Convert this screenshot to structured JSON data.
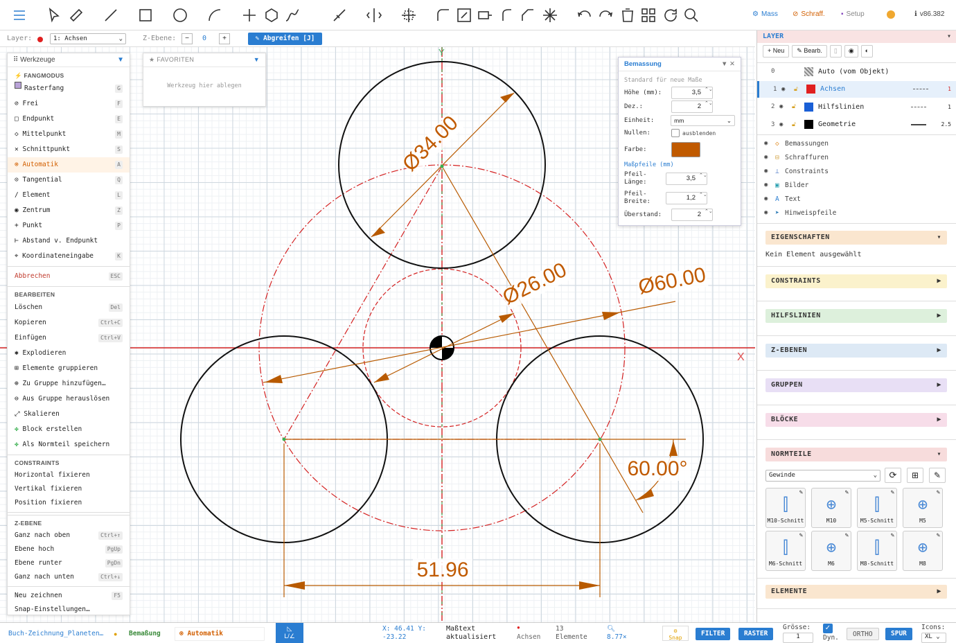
{
  "toolbar": {
    "mass": "Mass",
    "schraff": "Schraff.",
    "setup": "Setup",
    "version": "v86.382"
  },
  "layerbar": {
    "layer_label": "Layer:",
    "layer_value": "1: Achsen",
    "zebene_label": "Z-Ebene:",
    "zebene_value": "0",
    "abgreifen": "Abgreifen [J]"
  },
  "tools": {
    "title": "Werkzeuge",
    "fang_header": "FANGMODUS",
    "fang": [
      {
        "label": "Rasterfang",
        "key": "G"
      },
      {
        "label": "Frei",
        "key": "F"
      },
      {
        "label": "Endpunkt",
        "key": "E"
      },
      {
        "label": "Mittelpunkt",
        "key": "M"
      },
      {
        "label": "Schnittpunkt",
        "key": "S"
      },
      {
        "label": "Automatik",
        "key": "A"
      },
      {
        "label": "Tangential",
        "key": "Q"
      },
      {
        "label": "Element",
        "key": "L"
      },
      {
        "label": "Zentrum",
        "key": "Z"
      },
      {
        "label": "Punkt",
        "key": "P"
      },
      {
        "label": "Abstand v. Endpunkt",
        "key": ""
      },
      {
        "label": "Koordinateneingabe",
        "key": "K"
      }
    ],
    "abbrechen": {
      "label": "Abbrechen",
      "key": "ESC"
    },
    "bearbeiten_header": "BEARBEITEN",
    "bearbeiten": [
      {
        "label": "Löschen",
        "key": "Del"
      },
      {
        "label": "Kopieren",
        "key": "Ctrl+C"
      },
      {
        "label": "Einfügen",
        "key": "Ctrl+V"
      },
      {
        "label": "Explodieren",
        "key": ""
      },
      {
        "label": "Elemente gruppieren",
        "key": ""
      },
      {
        "label": "Zu Gruppe hinzufügen…",
        "key": ""
      },
      {
        "label": "Aus Gruppe herauslösen",
        "key": ""
      },
      {
        "label": "Skalieren",
        "key": ""
      },
      {
        "label": "Block erstellen",
        "key": ""
      },
      {
        "label": "Als Normteil speichern",
        "key": ""
      }
    ],
    "constraints_header": "CONSTRAINTS",
    "constraints": [
      "Horizontal fixieren",
      "Vertikal fixieren",
      "Position fixieren"
    ],
    "zebene_header": "Z-EBENE",
    "zebene": [
      {
        "label": "Ganz nach oben",
        "key": "Ctrl+↑"
      },
      {
        "label": "Ebene hoch",
        "key": "PgUp"
      },
      {
        "label": "Ebene runter",
        "key": "PgDn"
      },
      {
        "label": "Ganz nach unten",
        "key": "Ctrl+↓"
      }
    ],
    "neu_zeichnen": {
      "label": "Neu zeichnen",
      "key": "F5"
    },
    "snap_settings": "Snap-Einstellungen…"
  },
  "favoriten": {
    "title": "FAVORITEN",
    "placeholder": "Werkzeug hier ablegen"
  },
  "dim_panel": {
    "title": "Bemassung",
    "subtitle": "Standard für neue Maße",
    "hoehe_label": "Höhe (mm):",
    "hoehe": "3,5",
    "dez_label": "Dez.:",
    "dez": "2",
    "einheit_label": "Einheit:",
    "einheit": "mm",
    "nullen_label": "Nullen:",
    "nullen_opt": "ausblenden",
    "farbe_label": "Farbe:",
    "farbe": "#c05a00",
    "pfeile_header": "Maßpfeile (mm)",
    "pfeil_laenge_label": "Pfeil-Länge:",
    "pfeil_laenge": "3,5",
    "pfeil_breite_label": "Pfeil-Breite:",
    "pfeil_breite": "1,2",
    "ueberstand_label": "Überstand:",
    "ueberstand": "2"
  },
  "drawing": {
    "dims": {
      "d34": "Ø34.00",
      "d26": "Ø26.00",
      "d60": "Ø60.00",
      "len": "51.96",
      "ang": "60.00°"
    },
    "axis_x": "X",
    "axis_y": "Y"
  },
  "right": {
    "layer_title": "LAYER",
    "neu": "Neu",
    "bearb": "Bearb.",
    "layers": [
      {
        "num": "0",
        "name": "Auto (vom Objekt)",
        "color": ""
      },
      {
        "num": "1",
        "name": "Achsen",
        "color": "#e02020",
        "lw": "1"
      },
      {
        "num": "2",
        "name": "Hilfslinien",
        "color": "#1a5fd6",
        "lw": "1"
      },
      {
        "num": "3",
        "name": "Geometrie",
        "color": "#000000",
        "lw": "2.5"
      }
    ],
    "visibility": [
      {
        "icon": "◇",
        "label": "Bemassungen"
      },
      {
        "icon": "⊟",
        "label": "Schraffuren"
      },
      {
        "icon": "⊥",
        "label": "Constraints"
      },
      {
        "icon": "▣",
        "label": "Bilder"
      },
      {
        "icon": "A",
        "label": "Text"
      },
      {
        "icon": "➤",
        "label": "Hinweispfeile"
      }
    ],
    "eigenschaften": "EIGENSCHAFTEN",
    "kein_element": "Kein Element ausgewählt",
    "constraints": "CONSTRAINTS",
    "hilfslinien": "HILFSLINIEN",
    "zebenen": "Z-EBENEN",
    "gruppen": "GRUPPEN",
    "bloecke": "BLÖCKE",
    "normteile": "NORMTEILE",
    "normteil_select": "Gewinde",
    "normteil_items": [
      "M10-Schnitt",
      "M10",
      "M5-Schnitt",
      "M5",
      "M6-Schnitt",
      "M6",
      "M8-Schnitt",
      "M8"
    ],
    "elemente": "ELEMENTE"
  },
  "status": {
    "file": "Buch-Zeichnung_Planeten…",
    "tool": "Bemaßung",
    "snap": "Automatik",
    "coords": "X: 46.41 Y: -23.22",
    "msg": "Maßtext aktualisiert",
    "layer": "Achsen",
    "elements": "13 Elemente",
    "zoom": "8.77×",
    "snap_btn": "Snap",
    "filter": "FILTER",
    "raster": "RASTER",
    "groesse_label": "Grösse:",
    "groesse": "1",
    "dyn": "Dyn.",
    "ortho": "ORTHO",
    "spur": "SPUR",
    "icons_label": "Icons:",
    "icons": "XL"
  }
}
